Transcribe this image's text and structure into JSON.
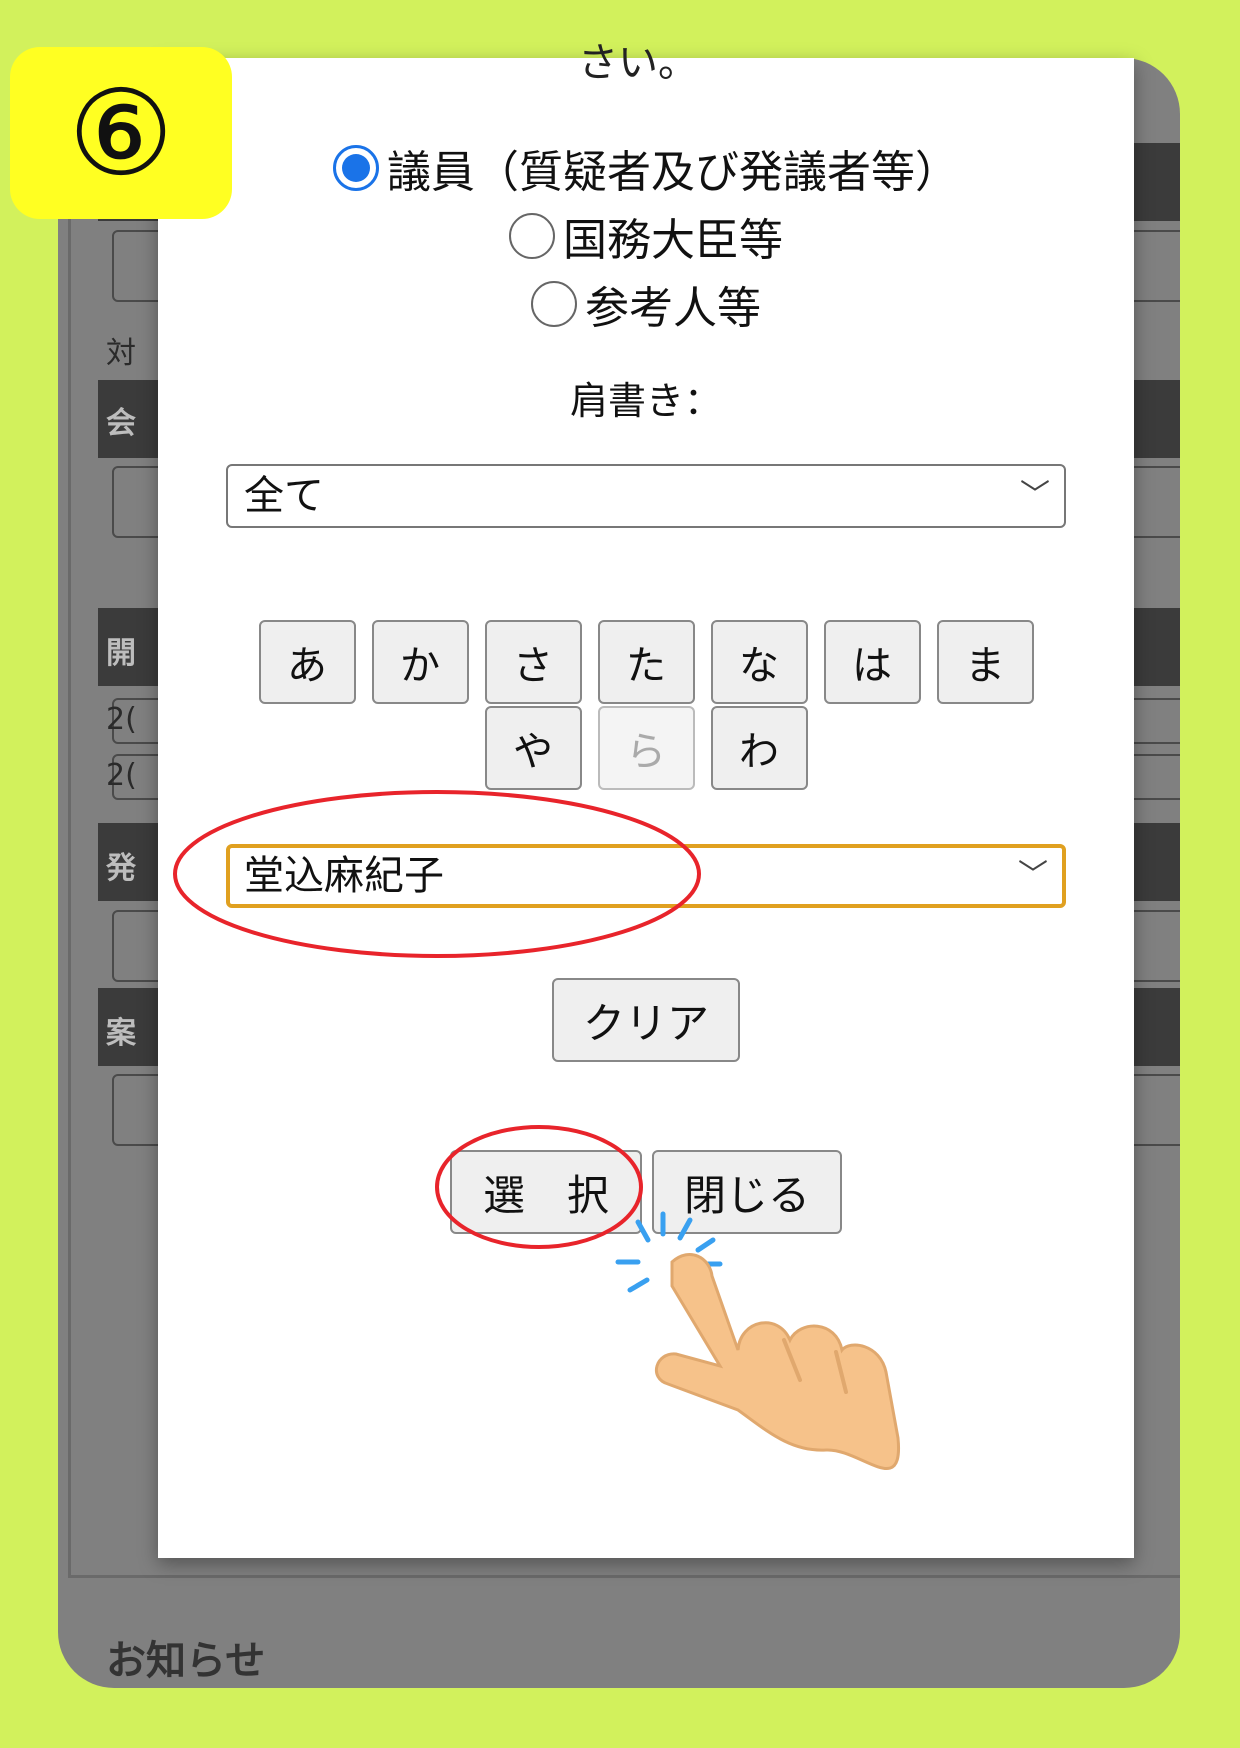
{
  "step_badge": "⑥",
  "modal": {
    "top_clipped_text": "さい。",
    "radios": [
      {
        "label": "議員（質疑者及び発議者等）",
        "checked": true
      },
      {
        "label": "国務大臣等",
        "checked": false
      },
      {
        "label": "参考人等",
        "checked": false
      }
    ],
    "title_label": "肩書き：",
    "title_select_value": "全て",
    "kana_row1": [
      "あ",
      "か",
      "さ",
      "た",
      "な",
      "は",
      "ま"
    ],
    "kana_row2": [
      {
        "label": "や",
        "disabled": false
      },
      {
        "label": "ら",
        "disabled": true
      },
      {
        "label": "わ",
        "disabled": false
      }
    ],
    "name_select_value": "堂込麻紀子",
    "clear_button": "クリア",
    "select_button": "選　択",
    "close_button": "閉じる"
  },
  "background": {
    "labels": [
      "対",
      "会",
      "開",
      "2(",
      "2(",
      "発",
      "案"
    ],
    "footer_text": "お知らせ"
  },
  "colors": {
    "page_bg": "#d2f15c",
    "badge_bg": "#ffff22",
    "radio_accent": "#1a73e8",
    "focus_border": "#e0a020",
    "annotation_red": "#e8242b",
    "tap_blue": "#39a0f0",
    "hand_skin": "#f6c28a"
  },
  "icons": {
    "pointer": "tap-hand-icon",
    "chevron": "chevron-down-icon"
  }
}
